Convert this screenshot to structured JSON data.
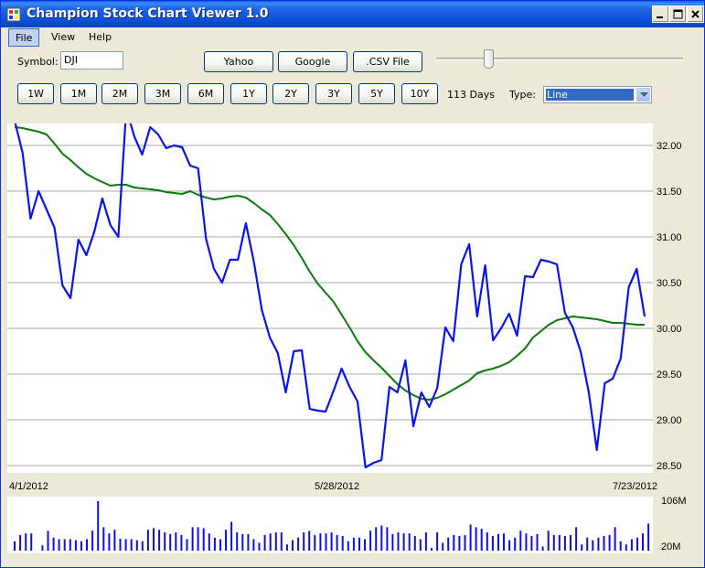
{
  "window": {
    "title": "Champion Stock Chart Viewer 1.0"
  },
  "menu": {
    "file": "File",
    "view": "View",
    "help": "Help"
  },
  "toolbar": {
    "symbol_label": "Symbol:",
    "symbol_value": "DJI",
    "source_buttons": [
      "Yahoo",
      "Google",
      ".CSV File"
    ],
    "slider_fraction": 0.2
  },
  "range": {
    "buttons": [
      "1W",
      "1M",
      "2M",
      "3M",
      "6M",
      "1Y",
      "2Y",
      "3Y",
      "5Y",
      "10Y"
    ],
    "days_label": "113 Days",
    "type_label": "Type:",
    "type_value": "Line"
  },
  "colors": {
    "price": "#0a14e6",
    "average": "#0a7a0a",
    "volume": "#1010dd",
    "grid": "#a9a9a9"
  },
  "chart_data": {
    "type": "line",
    "x_labels": [
      "4/1/2012",
      "5/28/2012",
      "7/23/2012"
    ],
    "y_ticks": [
      "32.00",
      "31.50",
      "31.00",
      "30.50",
      "30.00",
      "29.50",
      "29.00",
      "28.50"
    ],
    "ylim": [
      28.46,
      32.2
    ],
    "grid": true,
    "series": [
      {
        "values": [
          32.27,
          31.92,
          31.2,
          31.5,
          31.3,
          31.1,
          30.47,
          30.33,
          30.97,
          30.8,
          31.06,
          31.42,
          31.13,
          31.0,
          32.4,
          32.1,
          31.9,
          32.2,
          32.12,
          31.97,
          32.0,
          31.98,
          31.78,
          31.75,
          30.98,
          30.65,
          30.5,
          30.75,
          30.75,
          31.15,
          30.73,
          30.2,
          29.9,
          29.73,
          29.3,
          29.75,
          29.76,
          29.12,
          29.1,
          29.09,
          29.32,
          29.56,
          29.36,
          29.2,
          28.48,
          28.53,
          28.56,
          29.36,
          29.3,
          29.65,
          28.93,
          29.3,
          29.14,
          29.35,
          30.01,
          29.86,
          30.7,
          30.92,
          30.13,
          30.69,
          29.87,
          30.0,
          30.16,
          29.92,
          30.57,
          30.56,
          30.75,
          30.73,
          30.7,
          30.17,
          30.01,
          29.74,
          29.3,
          28.67,
          29.4,
          29.45,
          29.67,
          30.45,
          30.65,
          30.13
        ]
      },
      {
        "values": [
          32.2,
          32.19,
          32.17,
          32.15,
          32.12,
          32.02,
          31.91,
          31.84,
          31.76,
          31.69,
          31.64,
          31.6,
          31.56,
          31.57,
          31.57,
          31.54,
          31.53,
          31.52,
          31.51,
          31.49,
          31.48,
          31.47,
          31.5,
          31.46,
          31.43,
          31.41,
          31.42,
          31.44,
          31.45,
          31.43,
          31.37,
          31.3,
          31.24,
          31.14,
          31.03,
          30.91,
          30.77,
          30.62,
          30.49,
          30.39,
          30.29,
          30.15,
          30.01,
          29.86,
          29.74,
          29.65,
          29.57,
          29.48,
          29.39,
          29.32,
          29.27,
          29.23,
          29.22,
          29.24,
          29.28,
          29.33,
          29.38,
          29.43,
          29.51,
          29.54,
          29.56,
          29.59,
          29.63,
          29.7,
          29.78,
          29.9,
          29.97,
          30.04,
          30.09,
          30.11,
          30.13,
          30.12,
          30.11,
          30.1,
          30.08,
          30.06,
          30.06,
          30.05,
          30.04,
          30.04
        ]
      }
    ],
    "volume": {
      "axis_labels": [
        "106M",
        "20M"
      ],
      "values": [
        0.18,
        0.3,
        0.33,
        0.33,
        0.0,
        0.1,
        0.38,
        0.25,
        0.22,
        0.22,
        0.22,
        0.2,
        0.18,
        0.22,
        0.38,
        0.95,
        0.45,
        0.33,
        0.4,
        0.23,
        0.22,
        0.22,
        0.2,
        0.18,
        0.4,
        0.43,
        0.4,
        0.35,
        0.32,
        0.35,
        0.3,
        0.22,
        0.45,
        0.45,
        0.43,
        0.33,
        0.25,
        0.22,
        0.4,
        0.55,
        0.35,
        0.32,
        0.32,
        0.22,
        0.15,
        0.3,
        0.33,
        0.35,
        0.35,
        0.12,
        0.2,
        0.25,
        0.35,
        0.38,
        0.3,
        0.33,
        0.33,
        0.35,
        0.3,
        0.28,
        0.18,
        0.25,
        0.25,
        0.22,
        0.38,
        0.45,
        0.48,
        0.45,
        0.32,
        0.35,
        0.33,
        0.33,
        0.28,
        0.22,
        0.35,
        0.05,
        0.35,
        0.15,
        0.25,
        0.3,
        0.28,
        0.3,
        0.5,
        0.45,
        0.42,
        0.35,
        0.28,
        0.32,
        0.33,
        0.2,
        0.25,
        0.38,
        0.33,
        0.28,
        0.32,
        0.08,
        0.38,
        0.3,
        0.3,
        0.28,
        0.3,
        0.45,
        0.12,
        0.25,
        0.2,
        0.25,
        0.28,
        0.3,
        0.45,
        0.18,
        0.12,
        0.22,
        0.25,
        0.33,
        0.52
      ]
    }
  }
}
